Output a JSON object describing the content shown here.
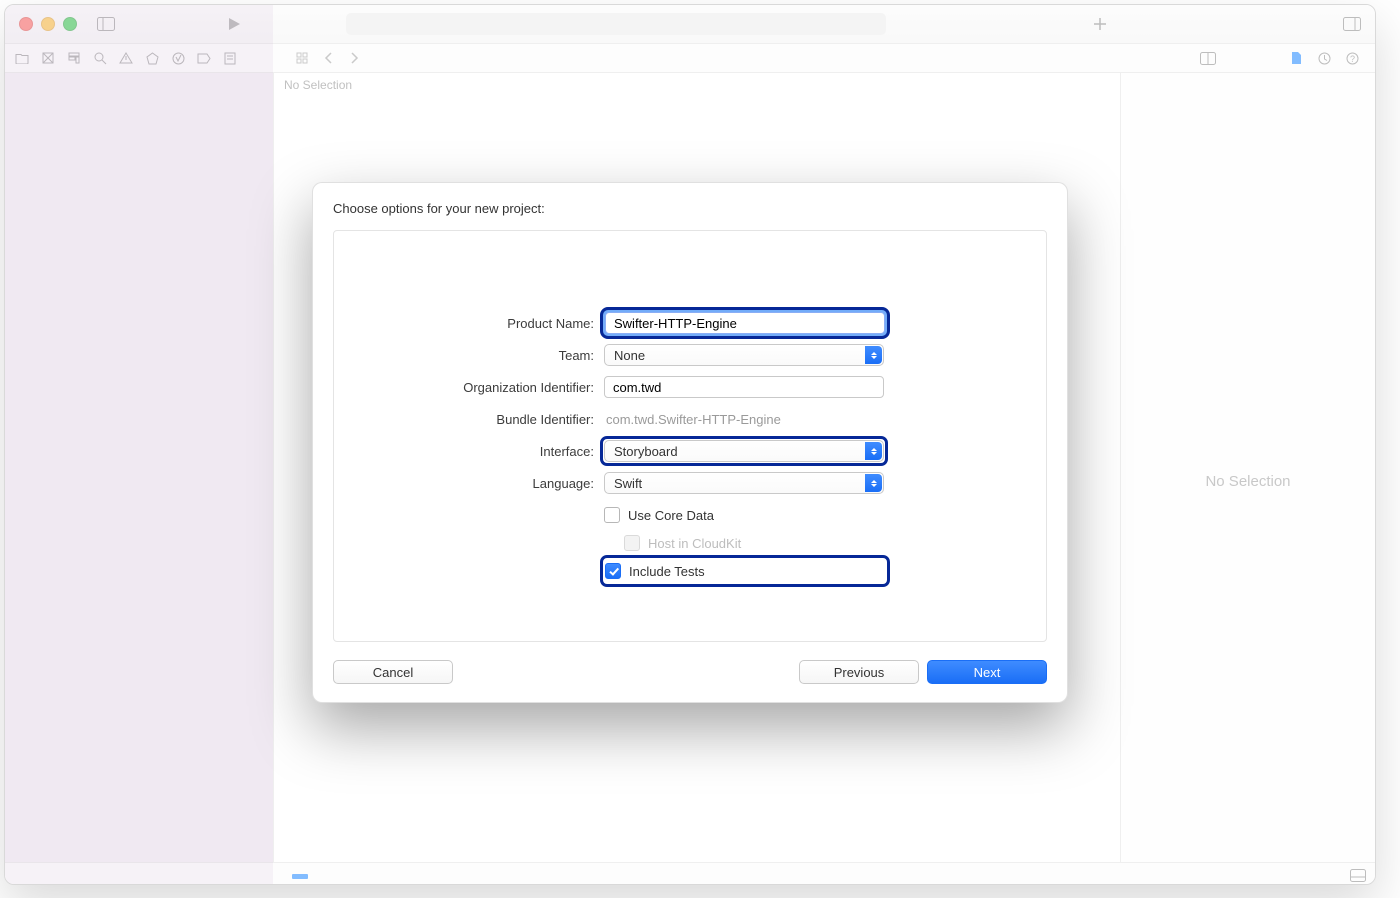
{
  "titlebar": {},
  "editor": {
    "no_selection": "No Selection"
  },
  "inspector": {
    "no_selection": "No Selection"
  },
  "modal": {
    "title": "Choose options for your new project:",
    "fields": {
      "product_name_label": "Product Name:",
      "product_name_value": "Swifter-HTTP-Engine",
      "team_label": "Team:",
      "team_value": "None",
      "org_id_label": "Organization Identifier:",
      "org_id_value": "com.twd",
      "bundle_id_label": "Bundle Identifier:",
      "bundle_id_value": "com.twd.Swifter-HTTP-Engine",
      "interface_label": "Interface:",
      "interface_value": "Storyboard",
      "language_label": "Language:",
      "language_value": "Swift",
      "use_core_data_label": "Use Core Data",
      "use_core_data_checked": false,
      "host_cloudkit_label": "Host in CloudKit",
      "host_cloudkit_enabled": false,
      "include_tests_label": "Include Tests",
      "include_tests_checked": true
    },
    "buttons": {
      "cancel": "Cancel",
      "previous": "Previous",
      "next": "Next"
    }
  },
  "colors": {
    "accent": "#1a6ef6",
    "highlight_box": "#062897"
  }
}
